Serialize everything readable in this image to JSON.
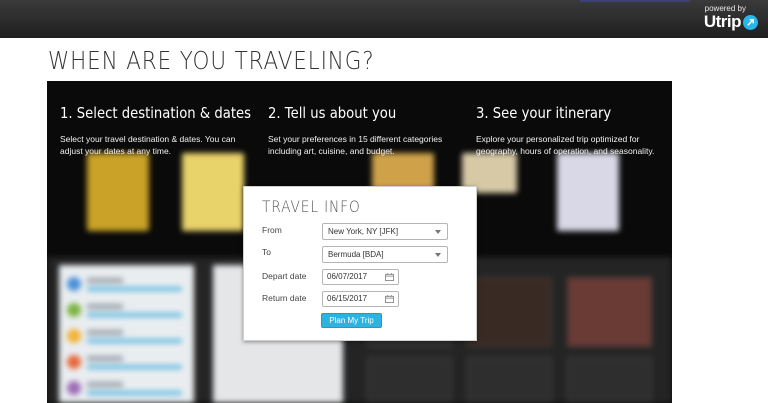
{
  "header": {
    "powered_by": "powered by",
    "brand": "Utrip",
    "brand_color": "#29b6e8"
  },
  "page": {
    "title": "WHEN ARE YOU TRAVELING?"
  },
  "steps": [
    {
      "title": "1. Select destination & dates",
      "text": "Select your travel destination & dates. You can adjust your dates at any time."
    },
    {
      "title": "2. Tell us about you",
      "text": "Set your preferences in 15 different categories including art, cuisine, and budget."
    },
    {
      "title": "3. See your itinerary",
      "text": "Explore your personalized trip optimized for geography, hours of operation, and seasonality."
    }
  ],
  "travel_info": {
    "title": "TRAVEL INFO",
    "from_label": "From",
    "from_value": "New York, NY [JFK]",
    "to_label": "To",
    "to_value": "Bermuda [BDA]",
    "depart_label": "Depart date",
    "depart_value": "06/07/2017",
    "return_label": "Return date",
    "return_value": "06/15/2017",
    "submit_label": "Plan My Trip",
    "button_color": "#2eb3df"
  },
  "icons": {
    "brand_arrow": "arrow-up-right-icon",
    "dropdown": "chevron-down-icon",
    "calendar": "calendar-icon"
  }
}
